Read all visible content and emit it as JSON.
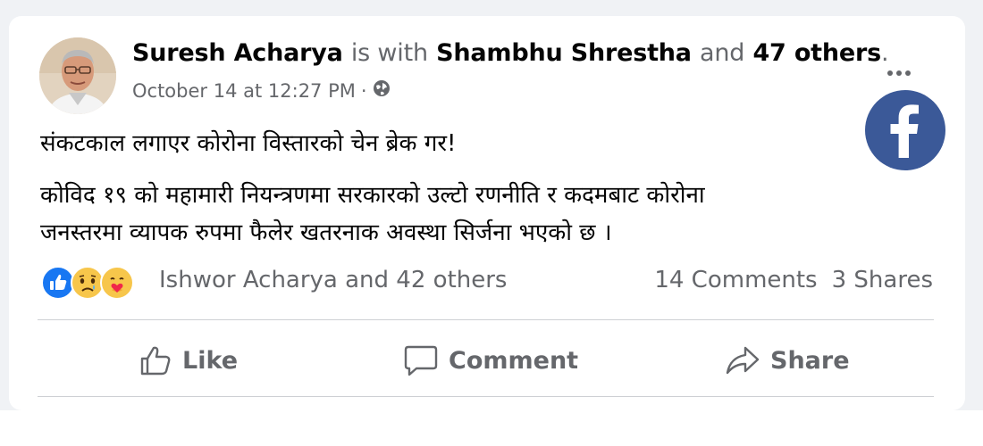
{
  "post": {
    "author": "Suresh Acharya",
    "with_text": "is with",
    "tagged": "Shambhu Shrestha",
    "and_text": "and",
    "others": "47 others",
    "period": ".",
    "timestamp": "October 14 at 12:27 PM",
    "separator": "·",
    "privacy_icon": "globe-icon",
    "lines": [
      "संकटकाल लगाएर कोरोना विस्तारको चेन ब्रेक गर!",
      "कोविद १९ को महामारी नियन्त्रणमा सरकारको उल्टो रणनीति र कदमबाट कोरोना",
      "जनस्तरमा व्यापक रुपमा फैलेर खतरनाक अवस्था सिर्जना भएको छ ।"
    ]
  },
  "reactions": {
    "icons": [
      "like-reaction-icon",
      "sad-reaction-icon",
      "care-reaction-icon"
    ],
    "reactors": "Ishwor Acharya and 42 others",
    "comments": "14 Comments",
    "shares": "3 Shares"
  },
  "actions": {
    "like": "Like",
    "comment": "Comment",
    "share": "Share"
  },
  "colors": {
    "facebook_blue": "#3b5998",
    "like_blue": "#1877f2",
    "muted_text": "#65676b",
    "text": "#050505"
  }
}
